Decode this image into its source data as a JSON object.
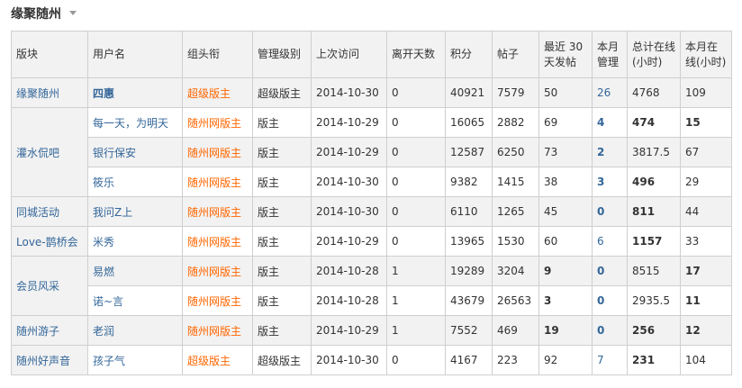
{
  "section": {
    "title": "缘聚随州",
    "dropdown_icon": "caret-down-icon"
  },
  "table": {
    "headers": {
      "board": "版块",
      "username": "用户名",
      "group": "组头衔",
      "level": "管理级别",
      "last_visit": "上次访问",
      "days_away": "离开天数",
      "points": "积分",
      "posts": "帖子",
      "recent30": "最近 30 天发帖",
      "month_admin": "本月管理",
      "total_online": "总计在线(小时)",
      "month_online": "本月在线(小时)"
    },
    "boards": {
      "b1": "缘聚随州",
      "b2": "灌水侃吧",
      "b3": "同城活动",
      "b4": "Love-鹊桥会",
      "b5": "会员风采",
      "b6": "随州游子",
      "b7": "随州好声音"
    },
    "rows": [
      {
        "username": "四惠",
        "group": "超级版主",
        "level": "超级版主",
        "last_visit": "2014-10-30",
        "days_away": "0",
        "points": "40921",
        "posts": "7579",
        "recent30": "50",
        "month_admin": "26",
        "total_online": "4768",
        "month_online": "109"
      },
      {
        "username": "每一天，为明天",
        "group": "随州网版主",
        "level": "版主",
        "last_visit": "2014-10-29",
        "days_away": "0",
        "points": "16065",
        "posts": "2882",
        "recent30": "69",
        "month_admin": "4",
        "total_online": "474",
        "month_online": "15"
      },
      {
        "username": "银行保安",
        "group": "随州网版主",
        "level": "版主",
        "last_visit": "2014-10-29",
        "days_away": "0",
        "points": "12587",
        "posts": "6250",
        "recent30": "73",
        "month_admin": "2",
        "total_online": "3817.5",
        "month_online": "67"
      },
      {
        "username": "筱乐",
        "group": "随州网版主",
        "level": "版主",
        "last_visit": "2014-10-30",
        "days_away": "0",
        "points": "9382",
        "posts": "1415",
        "recent30": "38",
        "month_admin": "3",
        "total_online": "496",
        "month_online": "29"
      },
      {
        "username": "我问Z上",
        "group": "随州网版主",
        "level": "版主",
        "last_visit": "2014-10-30",
        "days_away": "0",
        "points": "6110",
        "posts": "1265",
        "recent30": "45",
        "month_admin": "0",
        "total_online": "811",
        "month_online": "44"
      },
      {
        "username": "米秀",
        "group": "随州网版主",
        "level": "版主",
        "last_visit": "2014-10-29",
        "days_away": "0",
        "points": "13965",
        "posts": "1530",
        "recent30": "60",
        "month_admin": "6",
        "total_online": "1157",
        "month_online": "33"
      },
      {
        "username": "易燃",
        "group": "随州网版主",
        "level": "版主",
        "last_visit": "2014-10-28",
        "days_away": "1",
        "points": "19289",
        "posts": "3204",
        "recent30": "9",
        "month_admin": "0",
        "total_online": "8515",
        "month_online": "17"
      },
      {
        "username": "诺~言",
        "group": "随州网版主",
        "level": "版主",
        "last_visit": "2014-10-28",
        "days_away": "1",
        "points": "43679",
        "posts": "26563",
        "recent30": "3",
        "month_admin": "0",
        "total_online": "2935.5",
        "month_online": "11"
      },
      {
        "username": "老润",
        "group": "随州网版主",
        "level": "版主",
        "last_visit": "2014-10-29",
        "days_away": "1",
        "points": "7552",
        "posts": "469",
        "recent30": "19",
        "month_admin": "0",
        "total_online": "256",
        "month_online": "12"
      },
      {
        "username": "孩子气",
        "group": "超级版主",
        "level": "超级版主",
        "last_visit": "2014-10-30",
        "days_away": "0",
        "points": "4167",
        "posts": "223",
        "recent30": "92",
        "month_admin": "7",
        "total_online": "231",
        "month_online": "104"
      }
    ]
  },
  "colors": {
    "link": "#336699",
    "group": "#ff6600",
    "header_bg": "#f2f2f2",
    "border": "#cfcfcf"
  }
}
